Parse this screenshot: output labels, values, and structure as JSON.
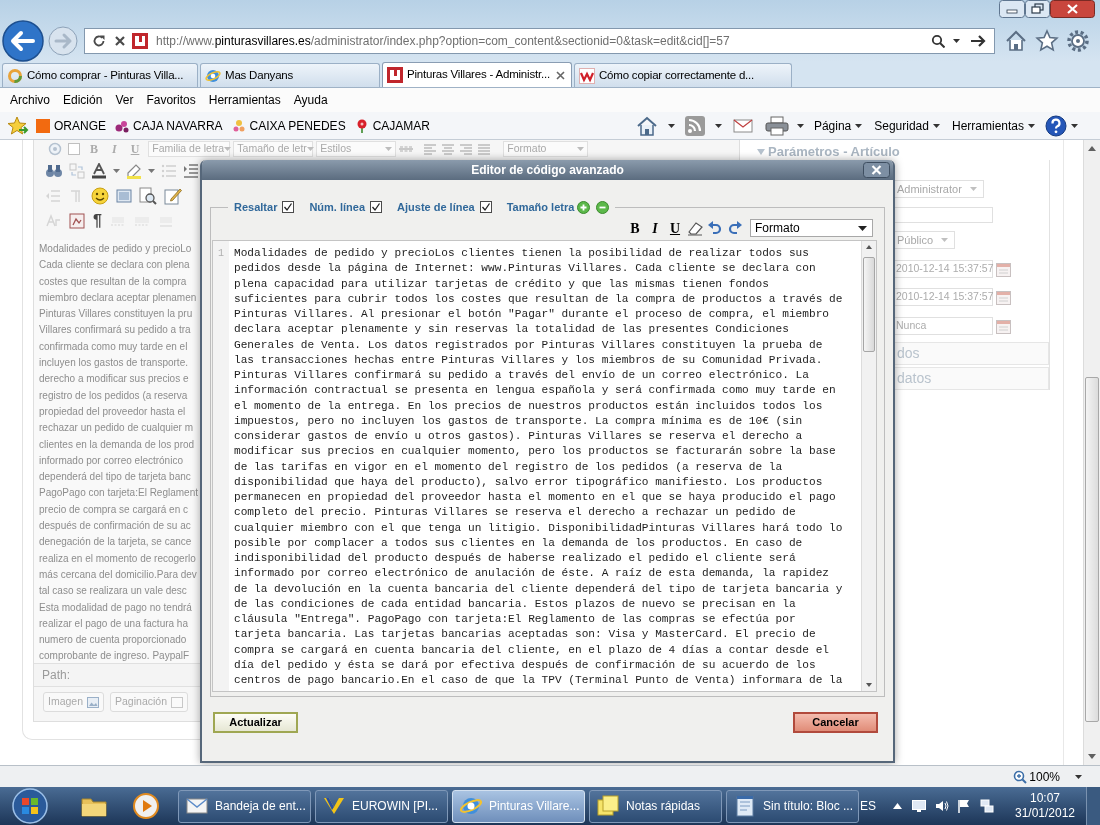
{
  "address_bar": {
    "url": {
      "scheme": "http://www.",
      "domain": "pinturasvillares.es",
      "path": "/administrator/index.php?option=com_content&sectionid=0&task=edit&cid[]=57"
    }
  },
  "tabs": [
    {
      "label": "Cómo comprar - Pinturas Villa...",
      "selected": false
    },
    {
      "label": "Mas Danyans",
      "selected": false
    },
    {
      "label": "Pinturas Villares - Administr...",
      "selected": true
    },
    {
      "label": "Cómo copiar correctamente d...",
      "selected": false
    }
  ],
  "menu_bar": [
    "Archivo",
    "Edición",
    "Ver",
    "Favoritos",
    "Herramientas",
    "Ayuda"
  ],
  "favorites_bar": [
    "ORANGE",
    "CAJA NAVARRA",
    "CAIXA PENEDES",
    "CAJAMAR"
  ],
  "command_bar": [
    "Página",
    "Seguridad",
    "Herramientas"
  ],
  "page": {
    "editor": {
      "style_buttons": [
        {
          "label": "B",
          "kind": "bold"
        },
        {
          "label": "I",
          "kind": "italic"
        },
        {
          "label": "U",
          "kind": "underline"
        }
      ],
      "selects": [
        "Familia de letra",
        "Tamaño de letr",
        "Estilos",
        "Formato"
      ],
      "paragraph_mark": "¶",
      "text_lines": [
        "Modalidades de pedido y precioLo",
        "Cada cliente se declara con plena",
        "costes que resultan de la compra",
        "miembro declara aceptar plenamen",
        "Pinturas Villares constituyen la pru",
        "Villares confirmará su pedido a tra",
        "confirmada como muy tarde en el",
        "incluyen los gastos de transporte.",
        "derecho a modificar sus precios e",
        "registro de los pedidos (a reserva",
        "propiedad del proveedor hasta el",
        "rechazar un pedido de cualquier m",
        "clientes en la demanda de los prod",
        "informado por correo electrónico",
        "dependerá del tipo de tarjeta banc",
        "PagoPago con tarjeta:El Reglament",
        "precio de compra se cargará en c",
        "después de confirmación de su ac",
        "denegación de la tarjeta, se cance",
        "realiza en el momento de recogerlo",
        "más cercana del domicilio.Para dev",
        "tal caso se realizara un vale desc",
        "Esta modalidad de pago no tendrá",
        "realizar el pago de una factura ha",
        "numero de cuenta proporcionado",
        "comprobante de ingreso. PaypalF"
      ],
      "path_label": "Path:",
      "buttons": [
        "Imagen",
        "Paginación"
      ]
    },
    "parameters": {
      "title": "Parámetros - Artículo",
      "fields": [
        {
          "kind": "select",
          "value": "Administrator"
        },
        {
          "kind": "text"
        },
        {
          "kind": "select",
          "value": "Público"
        },
        {
          "kind": "date",
          "value": "2010-12-14 15:37:57"
        },
        {
          "kind": "date",
          "value": "2010-12-14 15:37:57"
        },
        {
          "kind": "date",
          "value": "Nunca"
        }
      ],
      "sections": [
        "dos",
        "datos"
      ]
    }
  },
  "dialog": {
    "title": "Editor de código avanzado",
    "options": [
      {
        "label": "Resaltar",
        "checked": true
      },
      {
        "label": "Núm. línea",
        "checked": true
      },
      {
        "label": "Ajuste de línea",
        "checked": true
      }
    ],
    "font_size_label": "Tamaño letra",
    "format_buttons": [
      {
        "label": "B",
        "kind": "bold"
      },
      {
        "label": "I",
        "kind": "italic"
      },
      {
        "label": "U",
        "kind": "underline"
      }
    ],
    "format_select": "Formato",
    "line_number": "1",
    "code": "Modalidades de pedido y precioLos clientes tienen la posibilidad de realizar todos sus pedidos desde la página de Internet: www.Pinturas Villares. Cada cliente se declara con plena capacidad para utilizar tarjetas de crédito y que las mismas tienen fondos suficientes para cubrir todos los costes que resultan de la compra de productos a través de Pinturas Villares. Al presionar el botón \"Pagar\" durante el proceso de compra, el miembro declara aceptar plenamente y sin reservas la totalidad de las presentes Condiciones Generales de Venta. Los datos registrados por Pinturas Villares constituyen la prueba de las transacciones hechas entre Pinturas Villares y los miembros de su Comunidad Privada. Pinturas Villares confirmará su pedido a través del envío de un correo electrónico. La información contractual se presenta en lengua española y será confirmada como muy tarde en el momento de la entrega. En los precios de nuestros productos están incluidos todos los impuestos, pero no incluyen los gastos de transporte. La compra mínima es de 10€ (sin considerar gastos de envío u otros gastos). Pinturas Villares se reserva el derecho a modificar sus precios en cualquier momento, pero los productos se facturarán sobre la base de las tarifas en vigor en el momento del registro de los pedidos (a reserva de la disponibilidad que haya del producto), salvo error tipográfico manifiesto. Los productos permanecen en propiedad del proveedor hasta el momento en el que se haya producido el pago completo del precio. Pinturas Villares se reserva el derecho a rechazar un pedido de cualquier miembro con el que tenga un litigio. DisponibilidadPinturas Villares hará todo lo posible por complacer a todos sus clientes en la demanda de los productos. En caso de indisponibilidad del producto después de haberse realizado el pedido el cliente será informado por correo electrónico de anulación de éste. A raíz de esta demanda, la rapidez de la devolución en la cuenta bancaria del cliente dependerá del tipo de tarjeta bancaria y de las condiciones de cada entidad bancaria. Estos plazos de nuevo se precisan en la cláusula \"Entrega\". PagoPago con tarjeta:El Reglamento de las compras se efectúa por tarjeta bancaria. Las tarjetas bancarias aceptadas son: Visa y MasterCard. El precio de compra se cargará en cuenta bancaria del cliente, en el plazo de 4 días a contar desde el día del pedido y ésta se dará por efectiva después de confirmación de su acuerdo de los centros de pago bancario.En el caso de que la TPV (Terminal Punto de Venta) informara de la",
    "buttons": [
      {
        "label": "Actualizar",
        "kind": "confirm"
      },
      {
        "label": "Cancelar",
        "kind": "cancel"
      }
    ]
  },
  "status_bar": {
    "zoom": "100%"
  },
  "taskbar": {
    "buttons": [
      {
        "label": "Bandeja de ent...",
        "selected": false
      },
      {
        "label": "EUROWIN [PI...",
        "selected": false
      },
      {
        "label": "Pinturas Villare...",
        "selected": true
      },
      {
        "label": "Notas rápidas",
        "selected": false
      },
      {
        "label": "Sin título: Bloc ...",
        "selected": false
      }
    ],
    "language": "ES",
    "time": "10:07",
    "date": "31/01/2012"
  }
}
